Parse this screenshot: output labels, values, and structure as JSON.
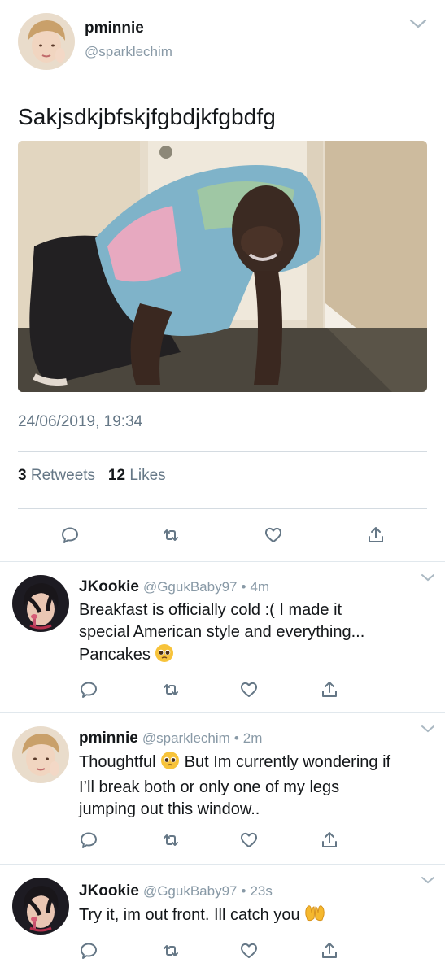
{
  "main_tweet": {
    "author_name": "pminnie",
    "author_handle": "@sparklechim",
    "text": "Sakjsdkjbfskjfgbdjkfgbdfg",
    "timestamp": "24/06/2019, 19:34",
    "retweets_count": "3",
    "retweets_label": "Retweets",
    "likes_count": "12",
    "likes_label": "Likes"
  },
  "replies": [
    {
      "name": "JKookie",
      "handle": "@GgukBaby97",
      "separator": "•",
      "time": "4m",
      "text_lines": [
        "Breakfast is officially cold :( I made it",
        "special American style and everything...",
        "Pancakes"
      ],
      "trailing_emoji": "pleading-face"
    },
    {
      "name": "pminnie",
      "handle": "@sparklechim",
      "separator": "•",
      "time": "2m",
      "text_lines": [
        "Thoughtful",
        "But Im currently wondering if",
        "I’ll break both or only one of my legs",
        "jumping out this window.."
      ],
      "inline_emoji": "pleading-face"
    },
    {
      "name": "JKookie",
      "handle": "@GgukBaby97",
      "separator": "•",
      "time": "23s",
      "text_lines": [
        "Try it, im out front. Ill catch you"
      ],
      "trailing_emoji": "open-hands"
    }
  ],
  "icons": {
    "reply": "reply-icon",
    "retweet": "retweet-icon",
    "like": "heart-icon",
    "share": "share-icon",
    "caret": "chevron-down-icon"
  },
  "colors": {
    "text": "#14171a",
    "secondary": "#657786",
    "handle": "#8899a6",
    "divider": "#e1e8ed"
  }
}
